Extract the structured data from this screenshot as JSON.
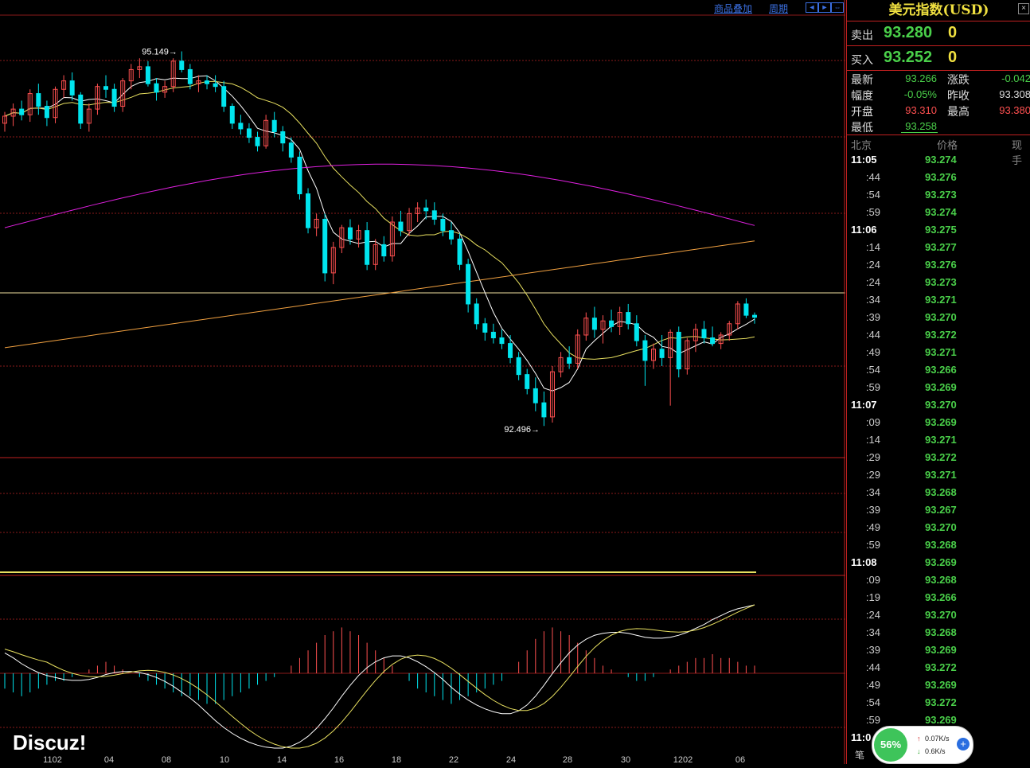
{
  "toolbar": {
    "overlay_label": "商品叠加",
    "period_label": "周期"
  },
  "chart_data": {
    "type": "candlestick",
    "x_ticks": [
      "1102",
      "04",
      "08",
      "10",
      "14",
      "16",
      "18",
      "22",
      "24",
      "28",
      "30",
      "1202",
      "06"
    ],
    "price_ylim": [
      92.3,
      95.4
    ],
    "annotations": [
      {
        "label": "95.149"
      },
      {
        "label": "92.496"
      }
    ],
    "candles": [
      [
        94.64,
        94.72,
        94.58,
        94.69
      ],
      [
        94.69,
        94.78,
        94.62,
        94.74
      ],
      [
        94.74,
        94.8,
        94.66,
        94.7
      ],
      [
        94.7,
        94.88,
        94.65,
        94.85
      ],
      [
        94.85,
        94.92,
        94.7,
        94.76
      ],
      [
        94.76,
        94.8,
        94.62,
        94.68
      ],
      [
        94.68,
        94.9,
        94.64,
        94.88
      ],
      [
        94.88,
        94.98,
        94.82,
        94.94
      ],
      [
        94.94,
        95.0,
        94.8,
        94.84
      ],
      [
        94.84,
        94.86,
        94.6,
        94.64
      ],
      [
        94.64,
        94.78,
        94.58,
        94.74
      ],
      [
        94.74,
        94.92,
        94.7,
        94.9
      ],
      [
        94.9,
        94.98,
        94.82,
        94.88
      ],
      [
        94.88,
        94.92,
        94.72,
        94.76
      ],
      [
        94.76,
        94.96,
        94.72,
        94.94
      ],
      [
        94.94,
        95.06,
        94.88,
        95.02
      ],
      [
        95.02,
        95.1,
        94.96,
        95.04
      ],
      [
        95.04,
        95.08,
        94.9,
        94.92
      ],
      [
        94.92,
        94.96,
        94.8,
        94.86
      ],
      [
        94.86,
        94.94,
        94.82,
        94.9
      ],
      [
        94.9,
        95.1,
        94.86,
        95.08
      ],
      [
        95.08,
        95.149,
        95.0,
        95.02
      ],
      [
        95.02,
        95.06,
        94.88,
        94.92
      ],
      [
        94.92,
        94.98,
        94.86,
        94.94
      ],
      [
        94.94,
        94.98,
        94.88,
        94.92
      ],
      [
        94.92,
        94.98,
        94.86,
        94.9
      ],
      [
        94.9,
        94.94,
        94.72,
        94.76
      ],
      [
        94.76,
        94.78,
        94.6,
        94.64
      ],
      [
        94.64,
        94.7,
        94.56,
        94.6
      ],
      [
        94.6,
        94.64,
        94.5,
        94.54
      ],
      [
        94.54,
        94.58,
        94.44,
        94.48
      ],
      [
        94.48,
        94.7,
        94.46,
        94.66
      ],
      [
        94.66,
        94.72,
        94.54,
        94.58
      ],
      [
        94.58,
        94.62,
        94.44,
        94.5
      ],
      [
        94.5,
        94.54,
        94.36,
        94.4
      ],
      [
        94.4,
        94.44,
        94.1,
        94.14
      ],
      [
        94.14,
        94.18,
        93.86,
        93.9
      ],
      [
        93.9,
        94.0,
        93.84,
        93.96
      ],
      [
        93.96,
        94.0,
        93.52,
        93.58
      ],
      [
        93.58,
        93.8,
        93.5,
        93.76
      ],
      [
        93.76,
        93.92,
        93.72,
        93.9
      ],
      [
        93.9,
        93.96,
        93.78,
        93.82
      ],
      [
        93.82,
        93.92,
        93.76,
        93.88
      ],
      [
        93.88,
        93.94,
        93.6,
        93.64
      ],
      [
        93.64,
        93.82,
        93.6,
        93.78
      ],
      [
        93.78,
        93.84,
        93.66,
        93.7
      ],
      [
        93.7,
        93.98,
        93.66,
        93.94
      ],
      [
        93.94,
        94.02,
        93.84,
        93.88
      ],
      [
        93.88,
        94.04,
        93.84,
        94.0
      ],
      [
        94.0,
        94.08,
        93.94,
        94.04
      ],
      [
        94.04,
        94.1,
        93.96,
        94.02
      ],
      [
        94.02,
        94.08,
        93.92,
        93.96
      ],
      [
        93.96,
        94.0,
        93.84,
        93.88
      ],
      [
        93.88,
        93.94,
        93.78,
        93.82
      ],
      [
        93.82,
        93.86,
        93.6,
        93.64
      ],
      [
        93.64,
        93.68,
        93.3,
        93.36
      ],
      [
        93.36,
        93.4,
        93.18,
        93.22
      ],
      [
        93.22,
        93.26,
        93.1,
        93.16
      ],
      [
        93.16,
        93.22,
        93.08,
        93.12
      ],
      [
        93.12,
        93.18,
        93.04,
        93.08
      ],
      [
        93.08,
        93.14,
        92.94,
        92.98
      ],
      [
        92.98,
        93.02,
        92.82,
        92.86
      ],
      [
        92.86,
        92.9,
        92.72,
        92.76
      ],
      [
        92.76,
        92.84,
        92.6,
        92.66
      ],
      [
        92.66,
        92.74,
        92.496,
        92.56
      ],
      [
        92.56,
        92.92,
        92.52,
        92.88
      ],
      [
        92.88,
        93.02,
        92.84,
        92.98
      ],
      [
        92.98,
        93.06,
        92.9,
        92.94
      ],
      [
        92.94,
        93.18,
        92.9,
        93.14
      ],
      [
        93.14,
        93.3,
        93.1,
        93.26
      ],
      [
        93.26,
        93.34,
        93.12,
        93.18
      ],
      [
        93.18,
        93.28,
        93.08,
        93.24
      ],
      [
        93.24,
        93.32,
        93.16,
        93.2
      ],
      [
        93.2,
        93.34,
        93.14,
        93.3
      ],
      [
        93.3,
        93.36,
        93.18,
        93.22
      ],
      [
        93.22,
        93.28,
        93.06,
        93.1
      ],
      [
        93.1,
        93.14,
        92.78,
        92.96
      ],
      [
        92.96,
        93.08,
        92.9,
        93.04
      ],
      [
        93.04,
        93.14,
        92.92,
        92.98
      ],
      [
        92.98,
        93.18,
        92.64,
        93.16
      ],
      [
        93.16,
        93.2,
        92.84,
        92.9
      ],
      [
        92.9,
        93.12,
        92.86,
        93.1
      ],
      [
        93.1,
        93.22,
        93.02,
        93.18
      ],
      [
        93.18,
        93.24,
        93.08,
        93.12
      ],
      [
        93.12,
        93.2,
        93.06,
        93.08
      ],
      [
        93.08,
        93.16,
        93.04,
        93.14
      ],
      [
        93.14,
        93.24,
        93.1,
        93.22
      ],
      [
        93.22,
        93.38,
        93.18,
        93.36
      ],
      [
        93.36,
        93.4,
        93.26,
        93.28
      ],
      [
        93.28,
        93.3,
        93.22,
        93.266
      ]
    ],
    "macd": [
      -0.04,
      -0.05,
      -0.06,
      -0.05,
      -0.04,
      -0.03,
      -0.02,
      -0.02,
      -0.01,
      0.0,
      0.01,
      0.02,
      0.03,
      0.02,
      0.01,
      0.0,
      -0.01,
      -0.02,
      -0.03,
      -0.04,
      -0.05,
      -0.06,
      -0.06,
      -0.07,
      -0.08,
      -0.08,
      -0.07,
      -0.06,
      -0.05,
      -0.04,
      -0.03,
      -0.02,
      -0.01,
      0.0,
      0.02,
      0.04,
      0.06,
      0.08,
      0.1,
      0.11,
      0.12,
      0.11,
      0.1,
      0.08,
      0.06,
      0.04,
      0.02,
      0.0,
      -0.02,
      -0.04,
      -0.05,
      -0.06,
      -0.07,
      -0.08,
      -0.07,
      -0.06,
      -0.05,
      -0.04,
      -0.03,
      -0.02,
      0.0,
      0.03,
      0.06,
      0.09,
      0.11,
      0.12,
      0.11,
      0.1,
      0.08,
      0.06,
      0.04,
      0.02,
      0.01,
      0.0,
      -0.01,
      -0.02,
      -0.02,
      -0.01,
      0.0,
      0.01,
      0.02,
      0.03,
      0.04,
      0.04,
      0.05,
      0.04,
      0.04,
      0.03,
      0.02,
      0.02
    ],
    "colors": {
      "up": "#ff5050",
      "down": "#00e5ee",
      "ma5": "#ffffff",
      "ma20": "#e8e060",
      "ma60": "#e020e0",
      "ma120": "#f0a040",
      "grid": "#8a1a1a",
      "hline": "#f0e0a0"
    }
  },
  "panel": {
    "title": "美元指数(USD)",
    "close": "×",
    "sell": {
      "label": "卖出",
      "price": "93.280",
      "vol": "0"
    },
    "buy": {
      "label": "买入",
      "price": "93.252",
      "vol": "0"
    },
    "quote": [
      {
        "label": "最新",
        "val": "93.266",
        "cls": "dn",
        "label2": "涨跌",
        "val2": "-0.042",
        "cls2": "dn"
      },
      {
        "label": "幅度",
        "val": "-0.05%",
        "cls": "dn",
        "label2": "昨收",
        "val2": "93.308",
        "cls2": "wh"
      },
      {
        "label": "开盘",
        "val": "93.310",
        "cls": "up",
        "label2": "最高",
        "val2": "93.380",
        "cls2": "up"
      },
      {
        "label": "最低",
        "val": "93.258",
        "cls": "dn",
        "label2": "",
        "val2": "",
        "cls2": "wh"
      }
    ],
    "tick_headers": {
      "time": "北京",
      "price": "价格",
      "vol": "现手"
    },
    "ticks": [
      {
        "t": "11:05",
        "p": "93.274",
        "major": true
      },
      {
        "t": ":44",
        "p": "93.276"
      },
      {
        "t": ":54",
        "p": "93.273"
      },
      {
        "t": ":59",
        "p": "93.274"
      },
      {
        "t": "11:06",
        "p": "93.275",
        "major": true
      },
      {
        "t": ":14",
        "p": "93.277"
      },
      {
        "t": ":24",
        "p": "93.276"
      },
      {
        "t": ":24",
        "p": "93.273"
      },
      {
        "t": ":34",
        "p": "93.271"
      },
      {
        "t": ":39",
        "p": "93.270"
      },
      {
        "t": ":44",
        "p": "93.272"
      },
      {
        "t": ":49",
        "p": "93.271"
      },
      {
        "t": ":54",
        "p": "93.266"
      },
      {
        "t": ":59",
        "p": "93.269"
      },
      {
        "t": "11:07",
        "p": "93.270",
        "major": true
      },
      {
        "t": ":09",
        "p": "93.269"
      },
      {
        "t": ":14",
        "p": "93.271"
      },
      {
        "t": ":29",
        "p": "93.272"
      },
      {
        "t": ":29",
        "p": "93.271"
      },
      {
        "t": ":34",
        "p": "93.268"
      },
      {
        "t": ":39",
        "p": "93.267"
      },
      {
        "t": ":49",
        "p": "93.270"
      },
      {
        "t": ":59",
        "p": "93.268"
      },
      {
        "t": "11:08",
        "p": "93.269",
        "major": true
      },
      {
        "t": ":09",
        "p": "93.268"
      },
      {
        "t": ":19",
        "p": "93.266"
      },
      {
        "t": ":24",
        "p": "93.270"
      },
      {
        "t": ":34",
        "p": "93.268"
      },
      {
        "t": ":39",
        "p": "93.269"
      },
      {
        "t": ":44",
        "p": "93.272"
      },
      {
        "t": ":49",
        "p": "93.269"
      },
      {
        "t": ":54",
        "p": "93.272"
      },
      {
        "t": ":59",
        "p": "93.269"
      }
    ],
    "tick_cut_time": "11:0",
    "bottom_char": "笔"
  },
  "badge": {
    "percent": "56%",
    "up_speed": "0.07K/s",
    "down_speed": "0.6K/s"
  },
  "watermark": "Discuz!"
}
